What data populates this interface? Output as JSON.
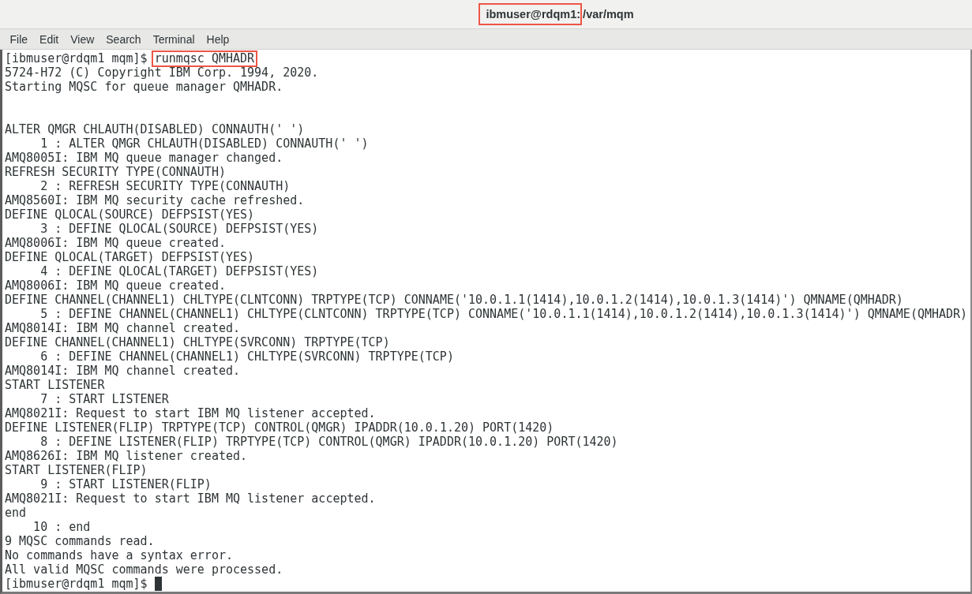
{
  "window": {
    "title_parts": [
      {
        "text": "ibmuser@rdqm1:",
        "highlighted": true
      },
      {
        "text": "/var/mqm",
        "highlighted": false
      }
    ]
  },
  "menu_bar": [
    "File",
    "Edit",
    "View",
    "Search",
    "Terminal",
    "Help"
  ],
  "terminal": {
    "lines": [
      {
        "kind": "prompt",
        "prompt": "[ibmuser@rdqm1 mqm]$",
        "command": "runmqsc QMHADR",
        "highlighted": true
      },
      {
        "kind": "text",
        "text": "5724-H72 (C) Copyright IBM Corp. 1994, 2020."
      },
      {
        "kind": "text",
        "text": "Starting MQSC for queue manager QMHADR."
      },
      {
        "kind": "blank"
      },
      {
        "kind": "blank"
      },
      {
        "kind": "text",
        "text": "ALTER QMGR CHLAUTH(DISABLED) CONNAUTH(' ')"
      },
      {
        "kind": "numbered",
        "text": "1 : ALTER QMGR CHLAUTH(DISABLED) CONNAUTH(' ')"
      },
      {
        "kind": "text",
        "text": "AMQ8005I: IBM MQ queue manager changed."
      },
      {
        "kind": "text",
        "text": "REFRESH SECURITY TYPE(CONNAUTH)"
      },
      {
        "kind": "numbered",
        "text": "2 : REFRESH SECURITY TYPE(CONNAUTH)"
      },
      {
        "kind": "text",
        "text": "AMQ8560I: IBM MQ security cache refreshed."
      },
      {
        "kind": "text",
        "text": "DEFINE QLOCAL(SOURCE) DEFPSIST(YES)"
      },
      {
        "kind": "numbered",
        "text": "3 : DEFINE QLOCAL(SOURCE) DEFPSIST(YES)"
      },
      {
        "kind": "text",
        "text": "AMQ8006I: IBM MQ queue created."
      },
      {
        "kind": "text",
        "text": "DEFINE QLOCAL(TARGET) DEFPSIST(YES)"
      },
      {
        "kind": "numbered",
        "text": "4 : DEFINE QLOCAL(TARGET) DEFPSIST(YES)"
      },
      {
        "kind": "text",
        "text": "AMQ8006I: IBM MQ queue created."
      },
      {
        "kind": "text",
        "text": "DEFINE CHANNEL(CHANNEL1) CHLTYPE(CLNTCONN) TRPTYPE(TCP) CONNAME('10.0.1.1(1414),10.0.1.2(1414),10.0.1.3(1414)') QMNAME(QMHADR)"
      },
      {
        "kind": "numbered",
        "text": "5 : DEFINE CHANNEL(CHANNEL1) CHLTYPE(CLNTCONN) TRPTYPE(TCP) CONNAME('10.0.1.1(1414),10.0.1.2(1414),10.0.1.3(1414)') QMNAME(QMHADR)"
      },
      {
        "kind": "text",
        "text": "AMQ8014I: IBM MQ channel created."
      },
      {
        "kind": "text",
        "text": "DEFINE CHANNEL(CHANNEL1) CHLTYPE(SVRCONN) TRPTYPE(TCP)"
      },
      {
        "kind": "numbered",
        "text": "6 : DEFINE CHANNEL(CHANNEL1) CHLTYPE(SVRCONN) TRPTYPE(TCP)"
      },
      {
        "kind": "text",
        "text": "AMQ8014I: IBM MQ channel created."
      },
      {
        "kind": "text",
        "text": "START LISTENER"
      },
      {
        "kind": "numbered",
        "text": "7 : START LISTENER"
      },
      {
        "kind": "text",
        "text": "AMQ8021I: Request to start IBM MQ listener accepted."
      },
      {
        "kind": "text",
        "text": "DEFINE LISTENER(FLIP) TRPTYPE(TCP) CONTROL(QMGR) IPADDR(10.0.1.20) PORT(1420)"
      },
      {
        "kind": "numbered",
        "text": "8 : DEFINE LISTENER(FLIP) TRPTYPE(TCP) CONTROL(QMGR) IPADDR(10.0.1.20) PORT(1420)"
      },
      {
        "kind": "text",
        "text": "AMQ8626I: IBM MQ listener created."
      },
      {
        "kind": "text",
        "text": "START LISTENER(FLIP)"
      },
      {
        "kind": "numbered",
        "text": "9 : START LISTENER(FLIP)"
      },
      {
        "kind": "text",
        "text": "AMQ8021I: Request to start IBM MQ listener accepted."
      },
      {
        "kind": "text",
        "text": "end"
      },
      {
        "kind": "numbered",
        "text": "10 : end"
      },
      {
        "kind": "text",
        "text": "9 MQSC commands read."
      },
      {
        "kind": "text",
        "text": "No commands have a syntax error."
      },
      {
        "kind": "text",
        "text": "All valid MQSC commands were processed."
      },
      {
        "kind": "prompt",
        "prompt": "[ibmuser@rdqm1 mqm]$",
        "cursor": true
      }
    ]
  }
}
